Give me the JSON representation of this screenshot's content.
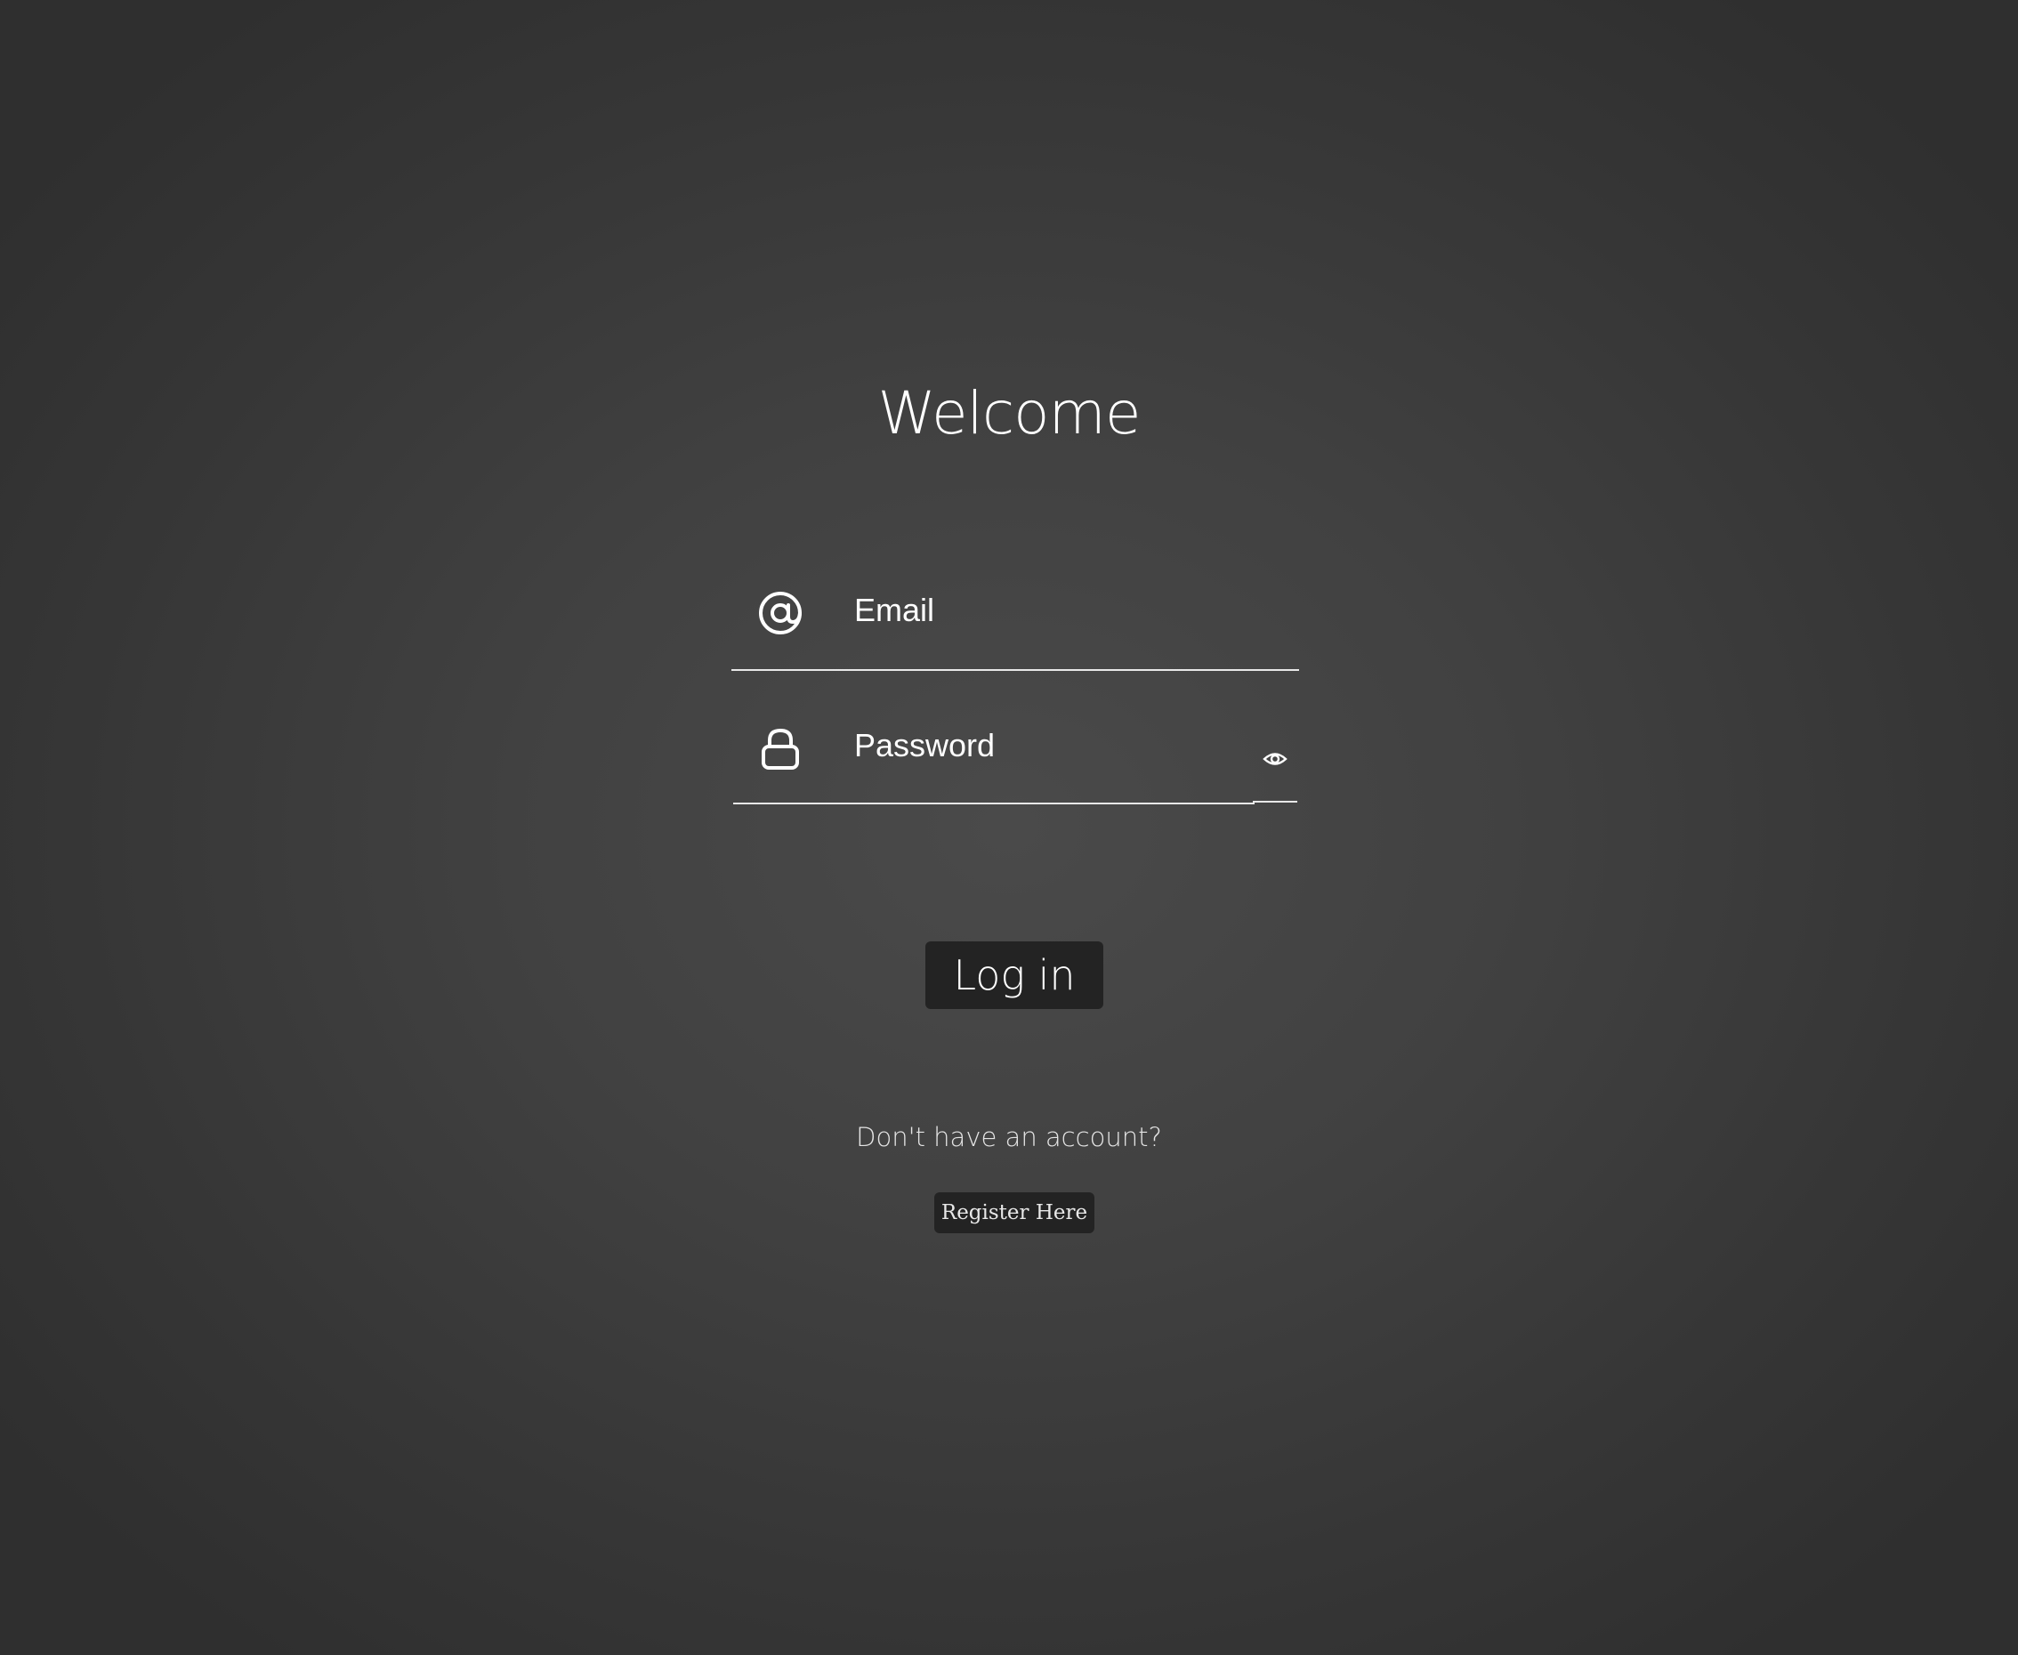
{
  "header": {
    "title": "Welcome"
  },
  "form": {
    "email": {
      "icon": "at-sign-icon",
      "placeholder": "Email",
      "value": ""
    },
    "password": {
      "icon": "lock-icon",
      "placeholder": "Password",
      "value": "",
      "toggle_icon": "eye-icon"
    },
    "login_label": "Log in"
  },
  "footer": {
    "prompt": "Don't have an account?",
    "register_label": "Register Here"
  },
  "colors": {
    "background_center": "#4a4a4a",
    "background_edge": "#2f2f2f",
    "button_bg": "#232323",
    "text": "#ffffff"
  }
}
